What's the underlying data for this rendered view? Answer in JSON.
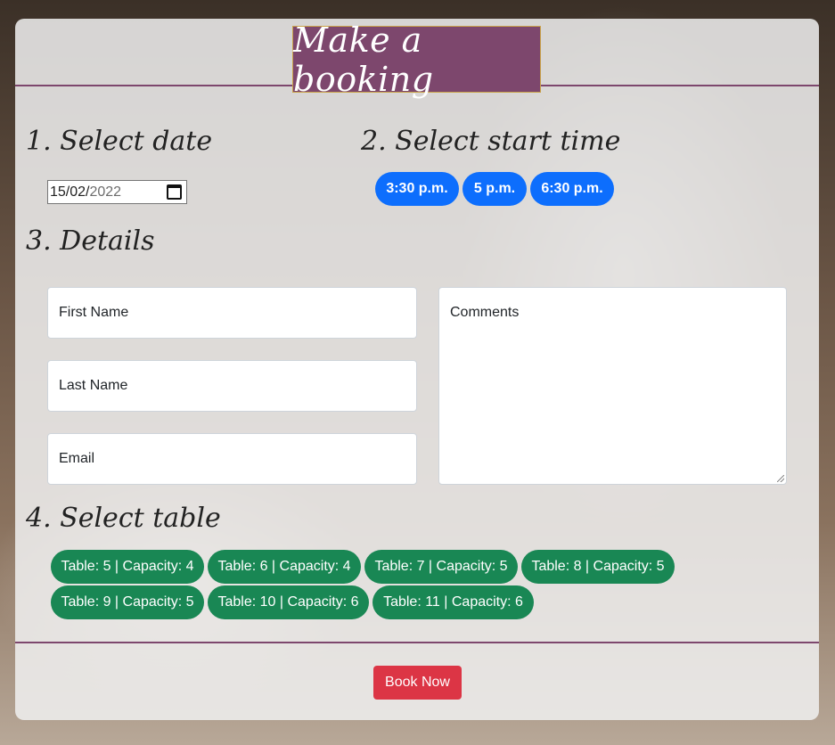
{
  "header": {
    "title": "Make a booking"
  },
  "sections": {
    "date": "1. Select date",
    "time": "2. Select start time",
    "details": "3. Details",
    "table": "4. Select table"
  },
  "date_input": {
    "day_month": "15/02/",
    "year": "2022"
  },
  "times": [
    "3:30 p.m.",
    "5 p.m.",
    "6:30 p.m."
  ],
  "details": {
    "first_name": "First Name",
    "last_name": "Last Name",
    "email": "Email",
    "comments": "Comments"
  },
  "tables": [
    "Table: 5 | Capacity: 4",
    "Table: 6 | Capacity: 4",
    "Table: 7 | Capacity: 5",
    "Table: 8 | Capacity: 5",
    "Table: 9 | Capacity: 5",
    "Table: 10 | Capacity: 6",
    "Table: 11 | Capacity: 6"
  ],
  "footer": {
    "book_label": "Book Now"
  },
  "colors": {
    "brand": "#7d476d",
    "time_button": "#0d6efd",
    "table_button": "#198754",
    "book_button": "#dc3545"
  }
}
